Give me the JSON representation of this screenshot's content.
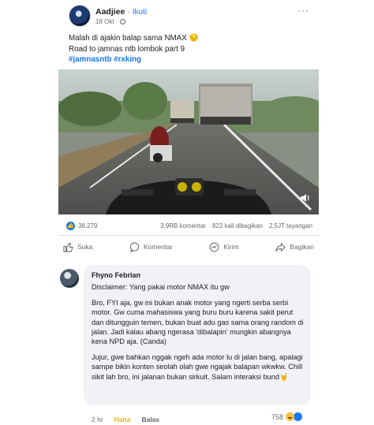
{
  "post": {
    "author": "Aadjiee",
    "separator": "·",
    "follow_label": "Ikuti",
    "date": "18 Okt ·",
    "more": "···",
    "caption_line1": "Malah di ajakin balap sama NMAX 😔",
    "caption_line2": "Road to jamnas ntb lombok part 9",
    "hashtags": "#jamnasntb #rxking",
    "likes": "38.279",
    "comments": "3,9RB komentar",
    "shares": "822 kali dibagikan",
    "views": "2,5JT tayangan",
    "actions": {
      "like": "Suka",
      "comment": "Komentar",
      "send": "Kirim",
      "share": "Bagikan"
    }
  },
  "comment": {
    "author": "Fhyno Febrian",
    "paragraphs": [
      "Disclaimer: Yang pakai motor NMAX itu gw",
      "Bro, FYI aja, gw ini bukan anak motor yang ngerti serba serbi motor. Gw cuma mahasiswa yang buru buru karena sakit perut dan ditungguin temen, bukan buat adu gas sama orang random di jalan. Jadi kalau abang ngerasa 'dibalapin' mungkin abangnya kena NPD aja. (Canda)",
      "Jujur, gwe bahkan nggak ngeh ada motor lu di jalan bang, apalagi sampe bikin konten seolah olah gwe ngajak balapan wkwkw. Chill sikit lah bro, ini jalanan bukan sirkuit. Salam interaksi bund🤘"
    ],
    "time": "2 hr",
    "reaction_label": "Haha",
    "reply_label": "Balas",
    "reaction_count": "758"
  },
  "colors": {
    "accent": "#1877f2",
    "bubble": "#f0f2f5",
    "muted": "#65676b"
  }
}
